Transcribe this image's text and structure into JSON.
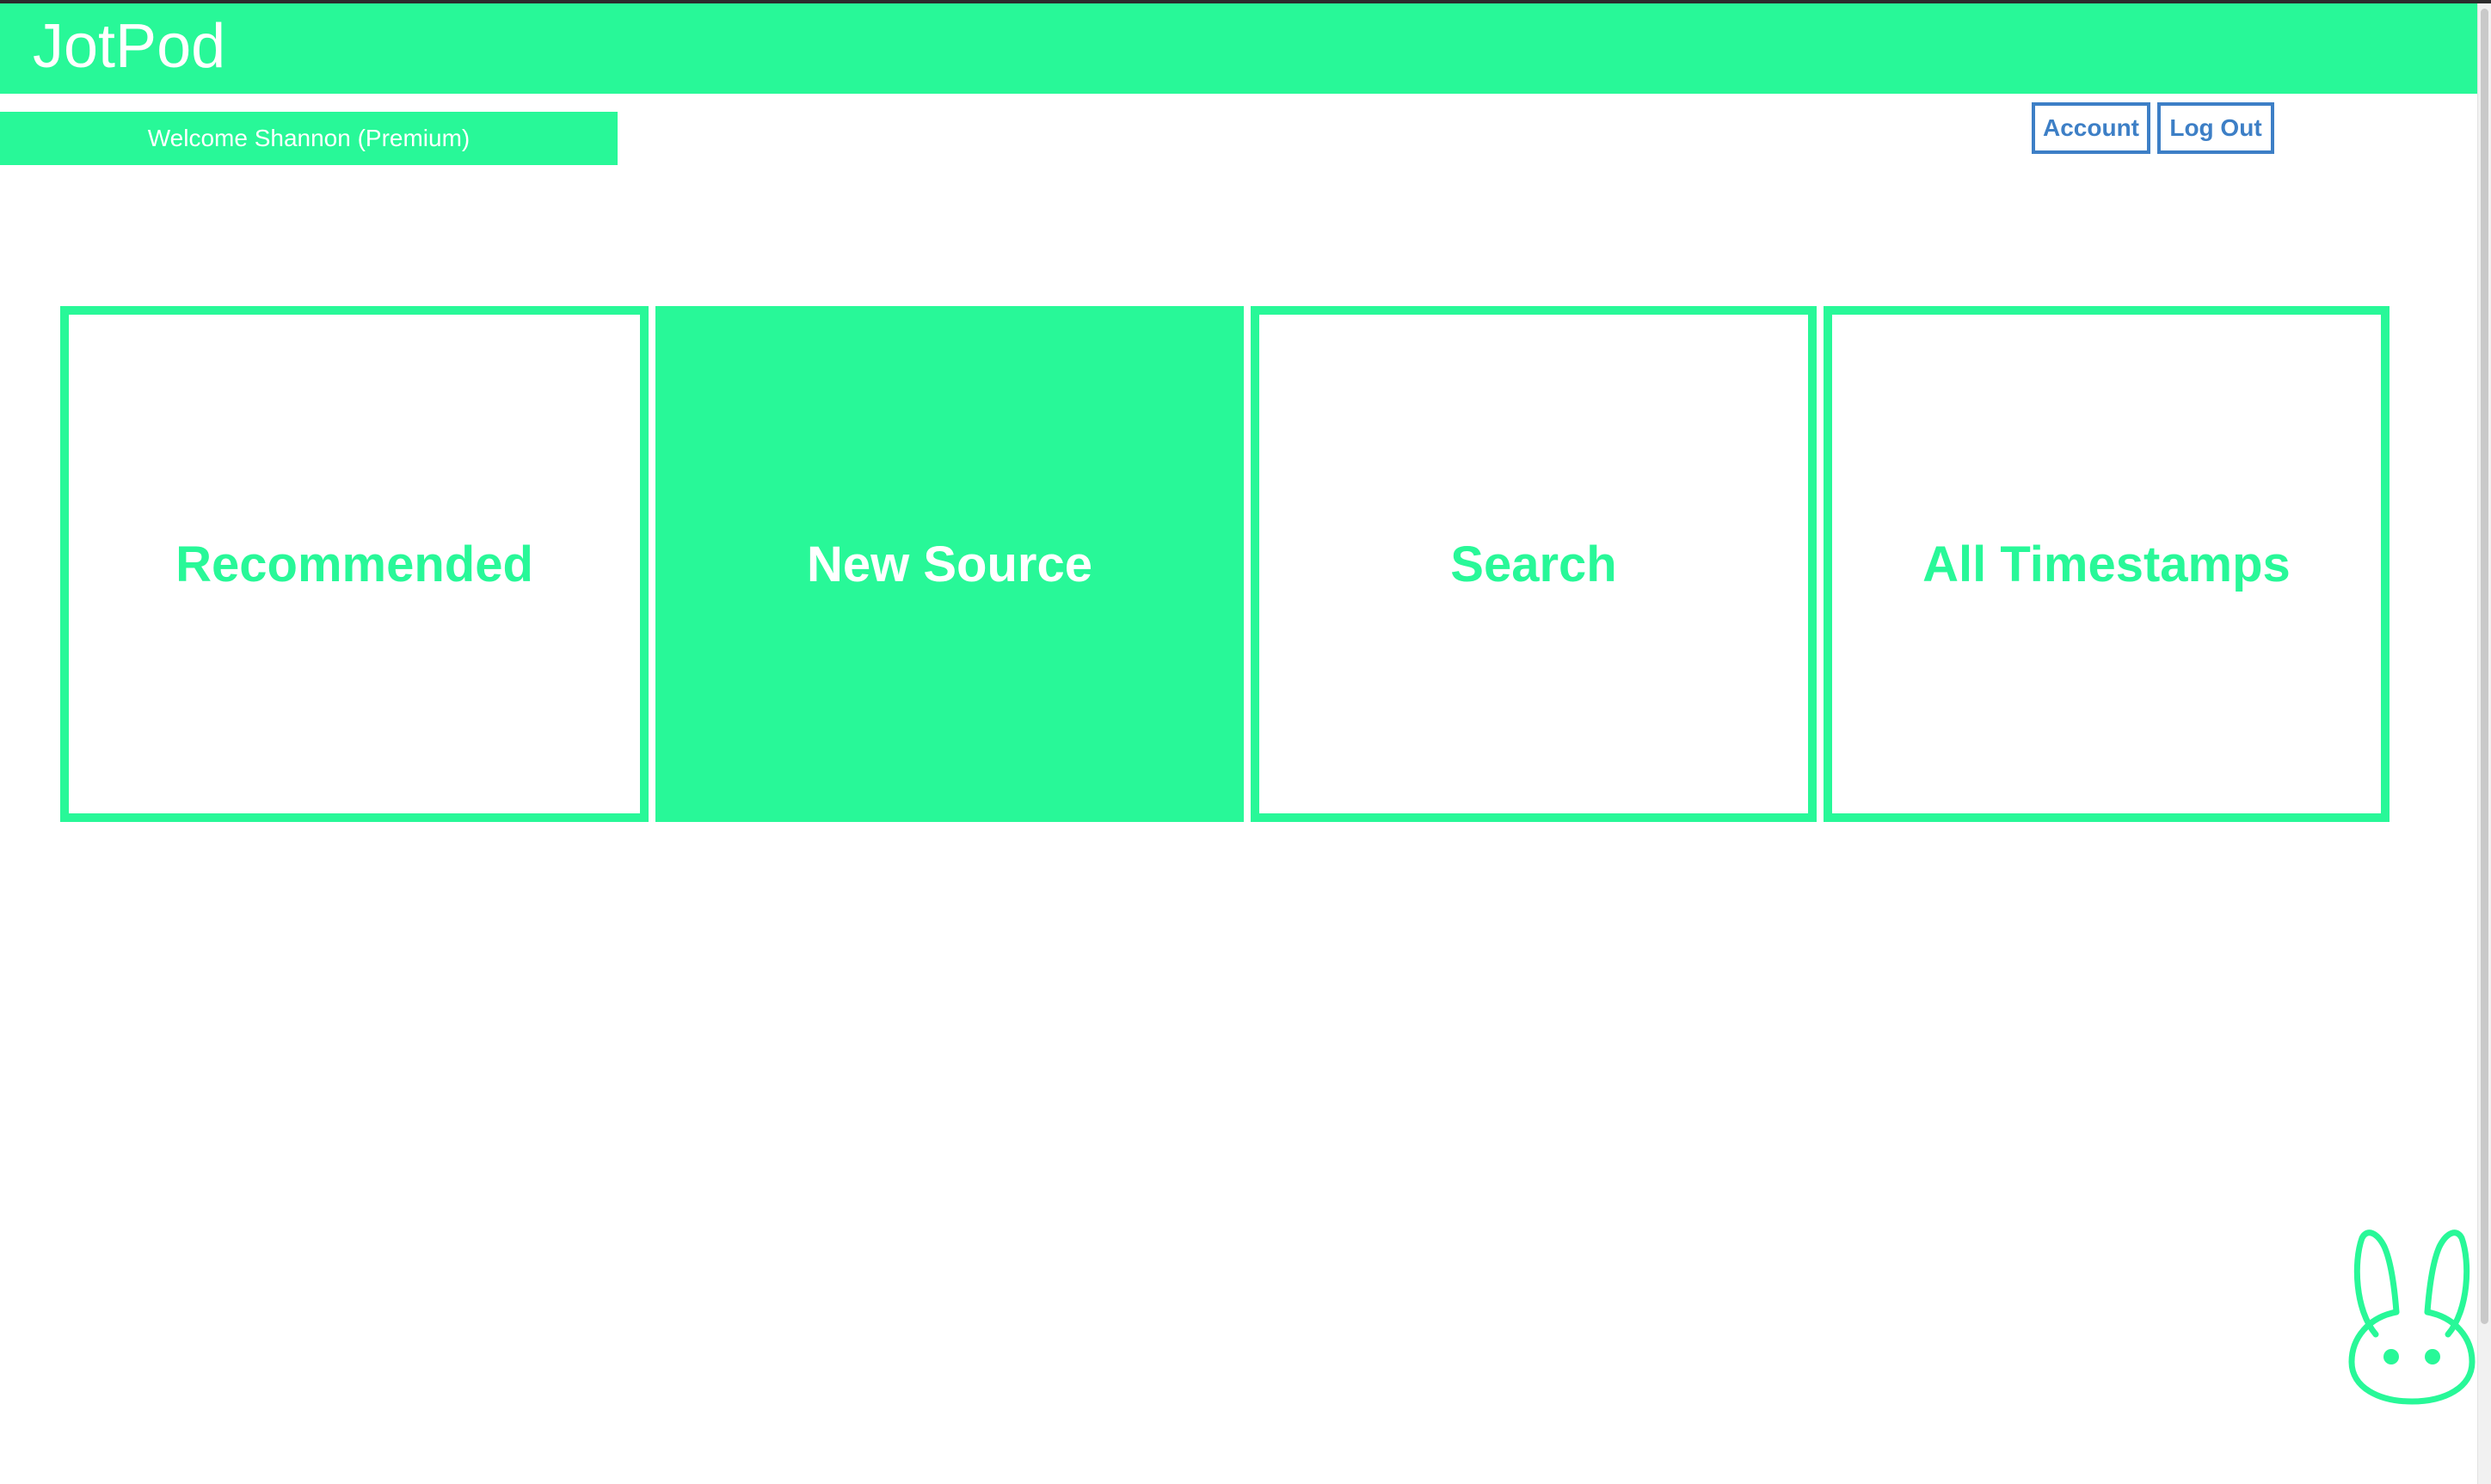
{
  "app": {
    "logo": "JotPod",
    "accent_color": "#28f898",
    "link_color": "#3d7fc6"
  },
  "user": {
    "welcome_text": "Welcome Shannon (Premium)"
  },
  "nav": {
    "account_label": "Account",
    "logout_label": "Log Out"
  },
  "tiles": [
    {
      "label": "Recommended",
      "style": "outline"
    },
    {
      "label": "New Source",
      "style": "filled"
    },
    {
      "label": "Search",
      "style": "outline"
    },
    {
      "label": "All Timestamps",
      "style": "outline"
    }
  ],
  "mascot": {
    "icon": "bunny-icon"
  }
}
